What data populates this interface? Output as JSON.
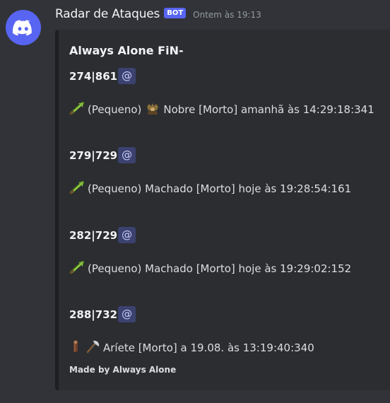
{
  "message": {
    "username": "Radar de Ataques",
    "bot_tag": "BOT",
    "timestamp": "Ontem às 19:13",
    "avatar_icon": "discord-logo-icon",
    "colors": {
      "background": "#313338",
      "embed_background": "#2b2d31",
      "embed_border": "#1e1f22",
      "blurple": "#5865f2",
      "mention_background": "#3c4270",
      "mention_text": "#c9cdfb"
    }
  },
  "embed": {
    "title": "Always Alone FiN-",
    "footer": "Made by Always Alone",
    "entries": [
      {
        "coords": "274|861",
        "mention": "@",
        "unit_icons": [
          "spear-unit-icon",
          "noble-unit-icon"
        ],
        "text_a": "(Pequeno)",
        "text_b": "Nobre [Morto] amanhã às 14:29:18:341"
      },
      {
        "coords": "279|729",
        "mention": "@",
        "unit_icons": [
          "spear-unit-icon"
        ],
        "text_a": "(Pequeno) Machado [Morto] hoje às 19:28:54:161"
      },
      {
        "coords": "282|729",
        "mention": "@",
        "unit_icons": [
          "spear-unit-icon"
        ],
        "text_a": "(Pequeno) Machado [Morto] hoje às 19:29:02:152"
      },
      {
        "coords": "288|732",
        "mention": "@",
        "unit_icons": [
          "ram-unit-icon",
          "axe-unit-icon"
        ],
        "text_a": "Aríete [Morto] a 19.08. às 13:19:40:340"
      }
    ]
  }
}
